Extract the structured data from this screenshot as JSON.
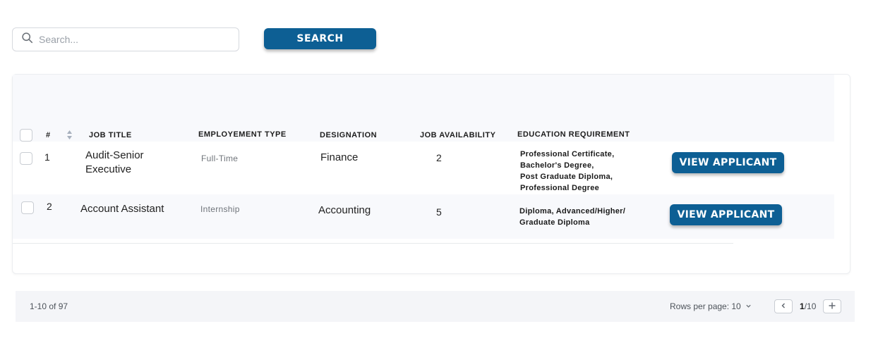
{
  "search": {
    "placeholder": "Search...",
    "button_label": "SEARCH"
  },
  "table": {
    "columns": [
      "#",
      "JOB TITLE",
      "EMPLOYEMENT TYPE",
      "DESIGNATION",
      "JOB AVAILABILITY",
      "EDUCATION REQUIREMENT"
    ],
    "rows": [
      {
        "num": "1",
        "title": "Audit-Senior\nExecutive",
        "type": "Full-Time",
        "designation": "Finance",
        "availability": "2",
        "education": "Professional Certificate,\nBachelor's Degree,\nPost Graduate Diploma,\nProfessional Degree",
        "action": "VIEW APPLICANT"
      },
      {
        "num": "2",
        "title": "Account Assistant",
        "type": "Internship",
        "designation": "Accounting",
        "availability": "5",
        "education": "Diploma, Advanced/Higher/\nGraduate Diploma",
        "action": "VIEW APPLICANT"
      }
    ]
  },
  "pagination": {
    "range": "1-10 of 97",
    "rows_per_page": "Rows per page: 10",
    "current_page": "1",
    "total_pages": "/10"
  },
  "colors": {
    "primary": "#0d5f94",
    "header_bg": "#f8f9fc",
    "footer_bg": "#f4f5f8"
  },
  "icons": {
    "search": "search-icon",
    "sort": "sort-icon",
    "rows_dropdown": "chevron-down-icon",
    "prev_page": "chevron-left-icon",
    "next_page": "plus-icon"
  }
}
